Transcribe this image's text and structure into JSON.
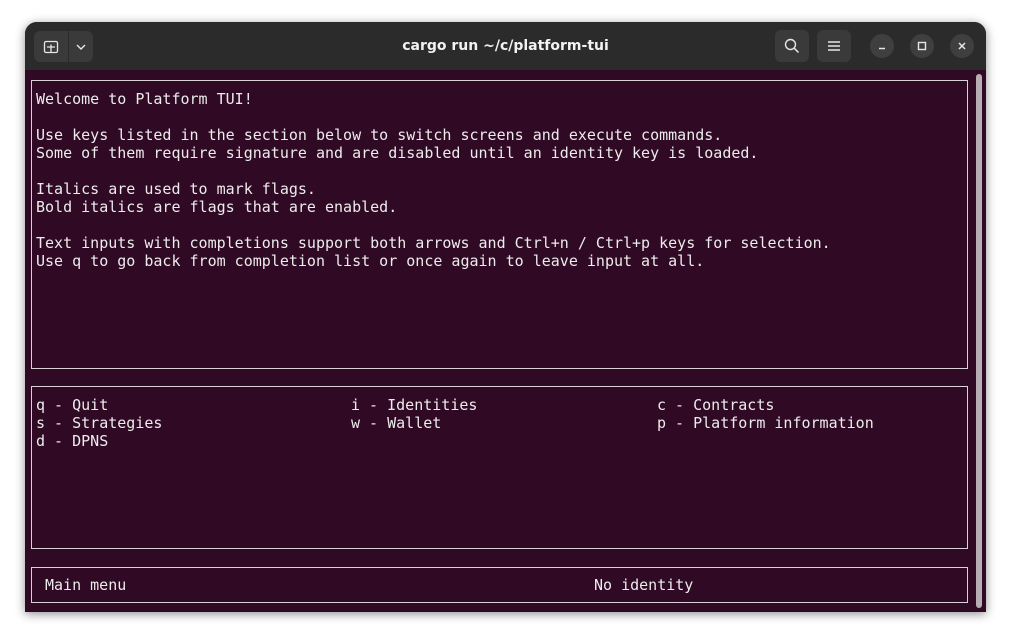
{
  "window": {
    "title": "cargo run ~/c/platform-tui"
  },
  "icons": {
    "new_tab": "new-tab-icon",
    "tab_menu": "chevron-down-icon",
    "search": "search-icon",
    "menu": "hamburger-menu-icon",
    "minimize": "minimize-icon",
    "maximize": "maximize-icon",
    "close": "close-icon"
  },
  "welcome": {
    "lines": [
      "Welcome to Platform TUI!",
      "Use keys listed in the section below to switch screens and execute commands.",
      "Some of them require signature and are disabled until an identity key is loaded.",
      "Italics are used to mark flags.",
      "Bold italics are flags that are enabled.",
      "Text inputs with completions support both arrows and Ctrl+n / Ctrl+p keys for selection.",
      "Use q to go back from completion list or once again to leave input at all."
    ]
  },
  "keys": [
    "q - Quit",
    "i - Identities",
    "c - Contracts",
    "s - Strategies",
    "w - Wallet",
    "p - Platform information",
    "d - DPNS"
  ],
  "status": {
    "screen": "Main menu",
    "identity": "No identity"
  },
  "colors": {
    "terminal_bg": "#300a24",
    "titlebar_bg": "#2b2b2b",
    "text": "#ececec",
    "border": "#d8d2d6"
  }
}
